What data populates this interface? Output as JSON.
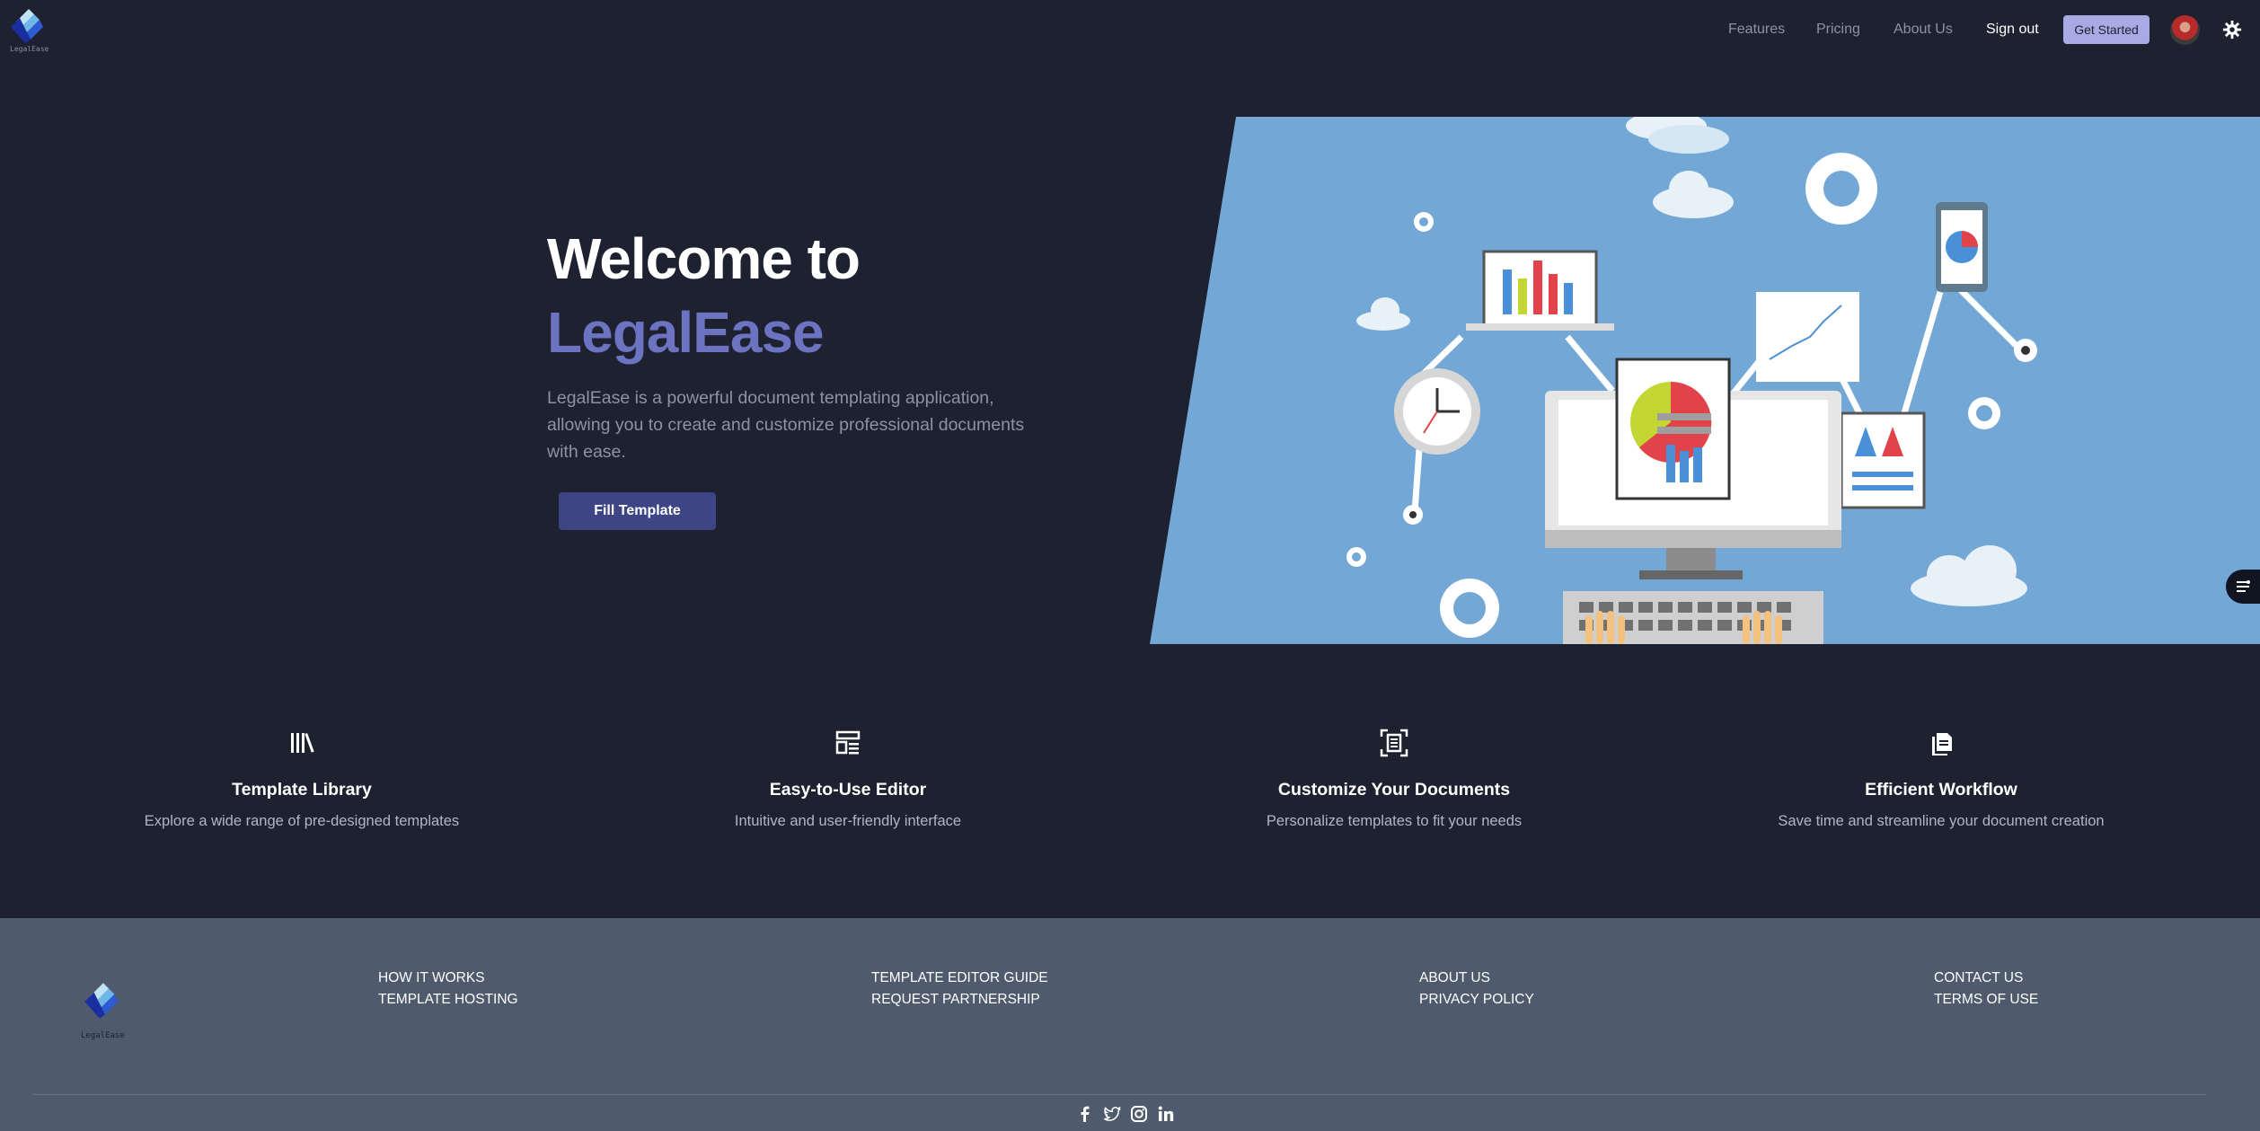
{
  "nav": {
    "logo_text": "LegalEase",
    "links": [
      "Features",
      "Pricing",
      "About Us"
    ],
    "signout": "Sign out",
    "cta": "Get Started"
  },
  "hero": {
    "title": "Welcome to",
    "brand": "LegalEase",
    "description": "LegalEase is a powerful document templating application, allowing you to create and customize professional documents with ease.",
    "button": "Fill Template"
  },
  "features": [
    {
      "icon": "library-icon",
      "title": "Template Library",
      "desc": "Explore a wide range of pre-designed templates"
    },
    {
      "icon": "layout-icon",
      "title": "Easy-to-Use Editor",
      "desc": "Intuitive and user-friendly interface"
    },
    {
      "icon": "scan-document-icon",
      "title": "Customize Your Documents",
      "desc": "Personalize templates to fit your needs"
    },
    {
      "icon": "copy-document-icon",
      "title": "Efficient Workflow",
      "desc": "Save time and streamline your document creation"
    }
  ],
  "footer": {
    "logo_text": "LegalEase",
    "columns": [
      [
        "HOW IT WORKS",
        "TEMPLATE HOSTING"
      ],
      [
        "TEMPLATE EDITOR GUIDE",
        "REQUEST PARTNERSHIP"
      ],
      [
        "ABOUT US",
        "PRIVACY POLICY"
      ],
      [
        "CONTACT US",
        "TERMS OF USE"
      ]
    ],
    "socials": [
      "facebook-icon",
      "twitter-icon",
      "instagram-icon",
      "linkedin-icon"
    ]
  },
  "colors": {
    "background": "#1d2130",
    "brand": "#6c73c0",
    "cta": "#a8abe3",
    "button": "#3e4585",
    "footer": "#4f5a6c",
    "illustration_sky": "#72a7d6"
  }
}
